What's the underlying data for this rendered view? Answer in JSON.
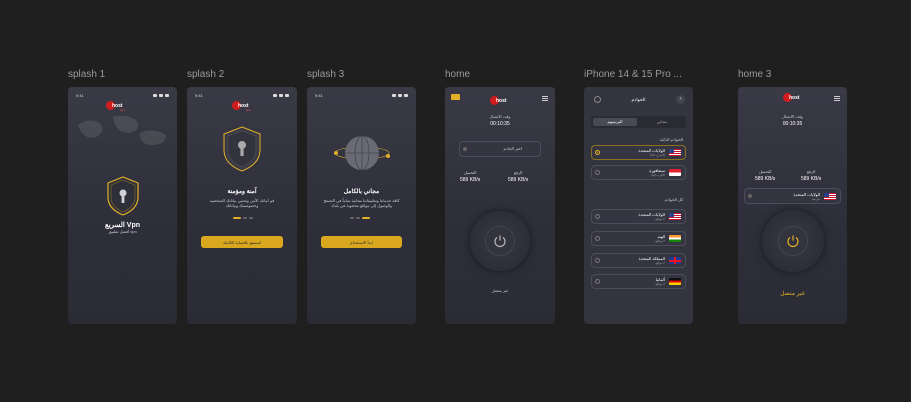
{
  "frames": [
    {
      "id": "splash1",
      "label": "splash 1"
    },
    {
      "id": "splash2",
      "label": "splash 2"
    },
    {
      "id": "splash3",
      "label": "splash 3"
    },
    {
      "id": "home",
      "label": "home"
    },
    {
      "id": "iphone",
      "label": "iPhone 14 & 15 Pro ..."
    },
    {
      "id": "home3",
      "label": "home 3"
    }
  ],
  "status_time": "9:41",
  "logo": {
    "text": "host",
    "sub": "vpn"
  },
  "splash1": {
    "title": "السريع Vpn",
    "subtitle": "أفضل تطبيق vpn"
  },
  "splash2": {
    "title": "آمنة ومؤمنة",
    "body1": "قم أمانك الآمن وتحمي بياناتك الشخصية",
    "body2": "وخصوصيتك وبياناتك",
    "button": "استمتع بالحماية الكاملة"
  },
  "splash3": {
    "title": "مجاني بالكامل",
    "body1": "كافة خدماتنا وتطبيقاتنا مجانية تماماً في التصفح",
    "body2": "والوصول إلى مواقع محجوبة في بلدك",
    "button": "ابدأ الاستخدام"
  },
  "home": {
    "time_label": "وقت الاتصال",
    "time_value": "00:10:35",
    "server": "اختر الخادم",
    "download_label": "التحميل",
    "download_value": "589 KB/s",
    "upload_label": "الرفع",
    "upload_value": "589 KB/s",
    "status": "غير متصل"
  },
  "iphone": {
    "header": "الخوادم",
    "tab_free": "مجاني",
    "tab_premium": "البريميوم",
    "smart_title": "الخوادم الذكية",
    "smart_rows": [
      {
        "name": "الولايات المتحدة",
        "sub": "الأسرع حالياً",
        "flag": "us",
        "selected": true
      },
      {
        "name": "سنغافورة",
        "sub": "الأقرب إليك",
        "flag": "sg",
        "selected": false
      }
    ],
    "all_title": "كل الخوادم",
    "all_rows": [
      {
        "name": "الولايات المتحدة",
        "sub": "٣ مواقع",
        "flag": "us"
      },
      {
        "name": "الهند",
        "sub": "٣ مواقع",
        "flag": "in"
      },
      {
        "name": "المملكة المتحدة",
        "sub": "٣ مواقع",
        "flag": "gb"
      },
      {
        "name": "ألمانيا",
        "sub": "٣ مواقع",
        "flag": "de"
      }
    ]
  },
  "home3": {
    "time_label": "وقت الاتصال",
    "time_value": "00:10:35",
    "download_label": "التحميل",
    "download_value": "589 KB/s",
    "upload_label": "الرفع",
    "upload_value": "589 KB/s",
    "server_name": "الولايات المتحدة",
    "server_sub": "سريعة",
    "status": "غير متصل"
  },
  "colors": {
    "accent": "#e2b127",
    "logo_red": "#d01c1c",
    "phone_bg": "#34343f",
    "canvas": "#1f1f1f"
  }
}
